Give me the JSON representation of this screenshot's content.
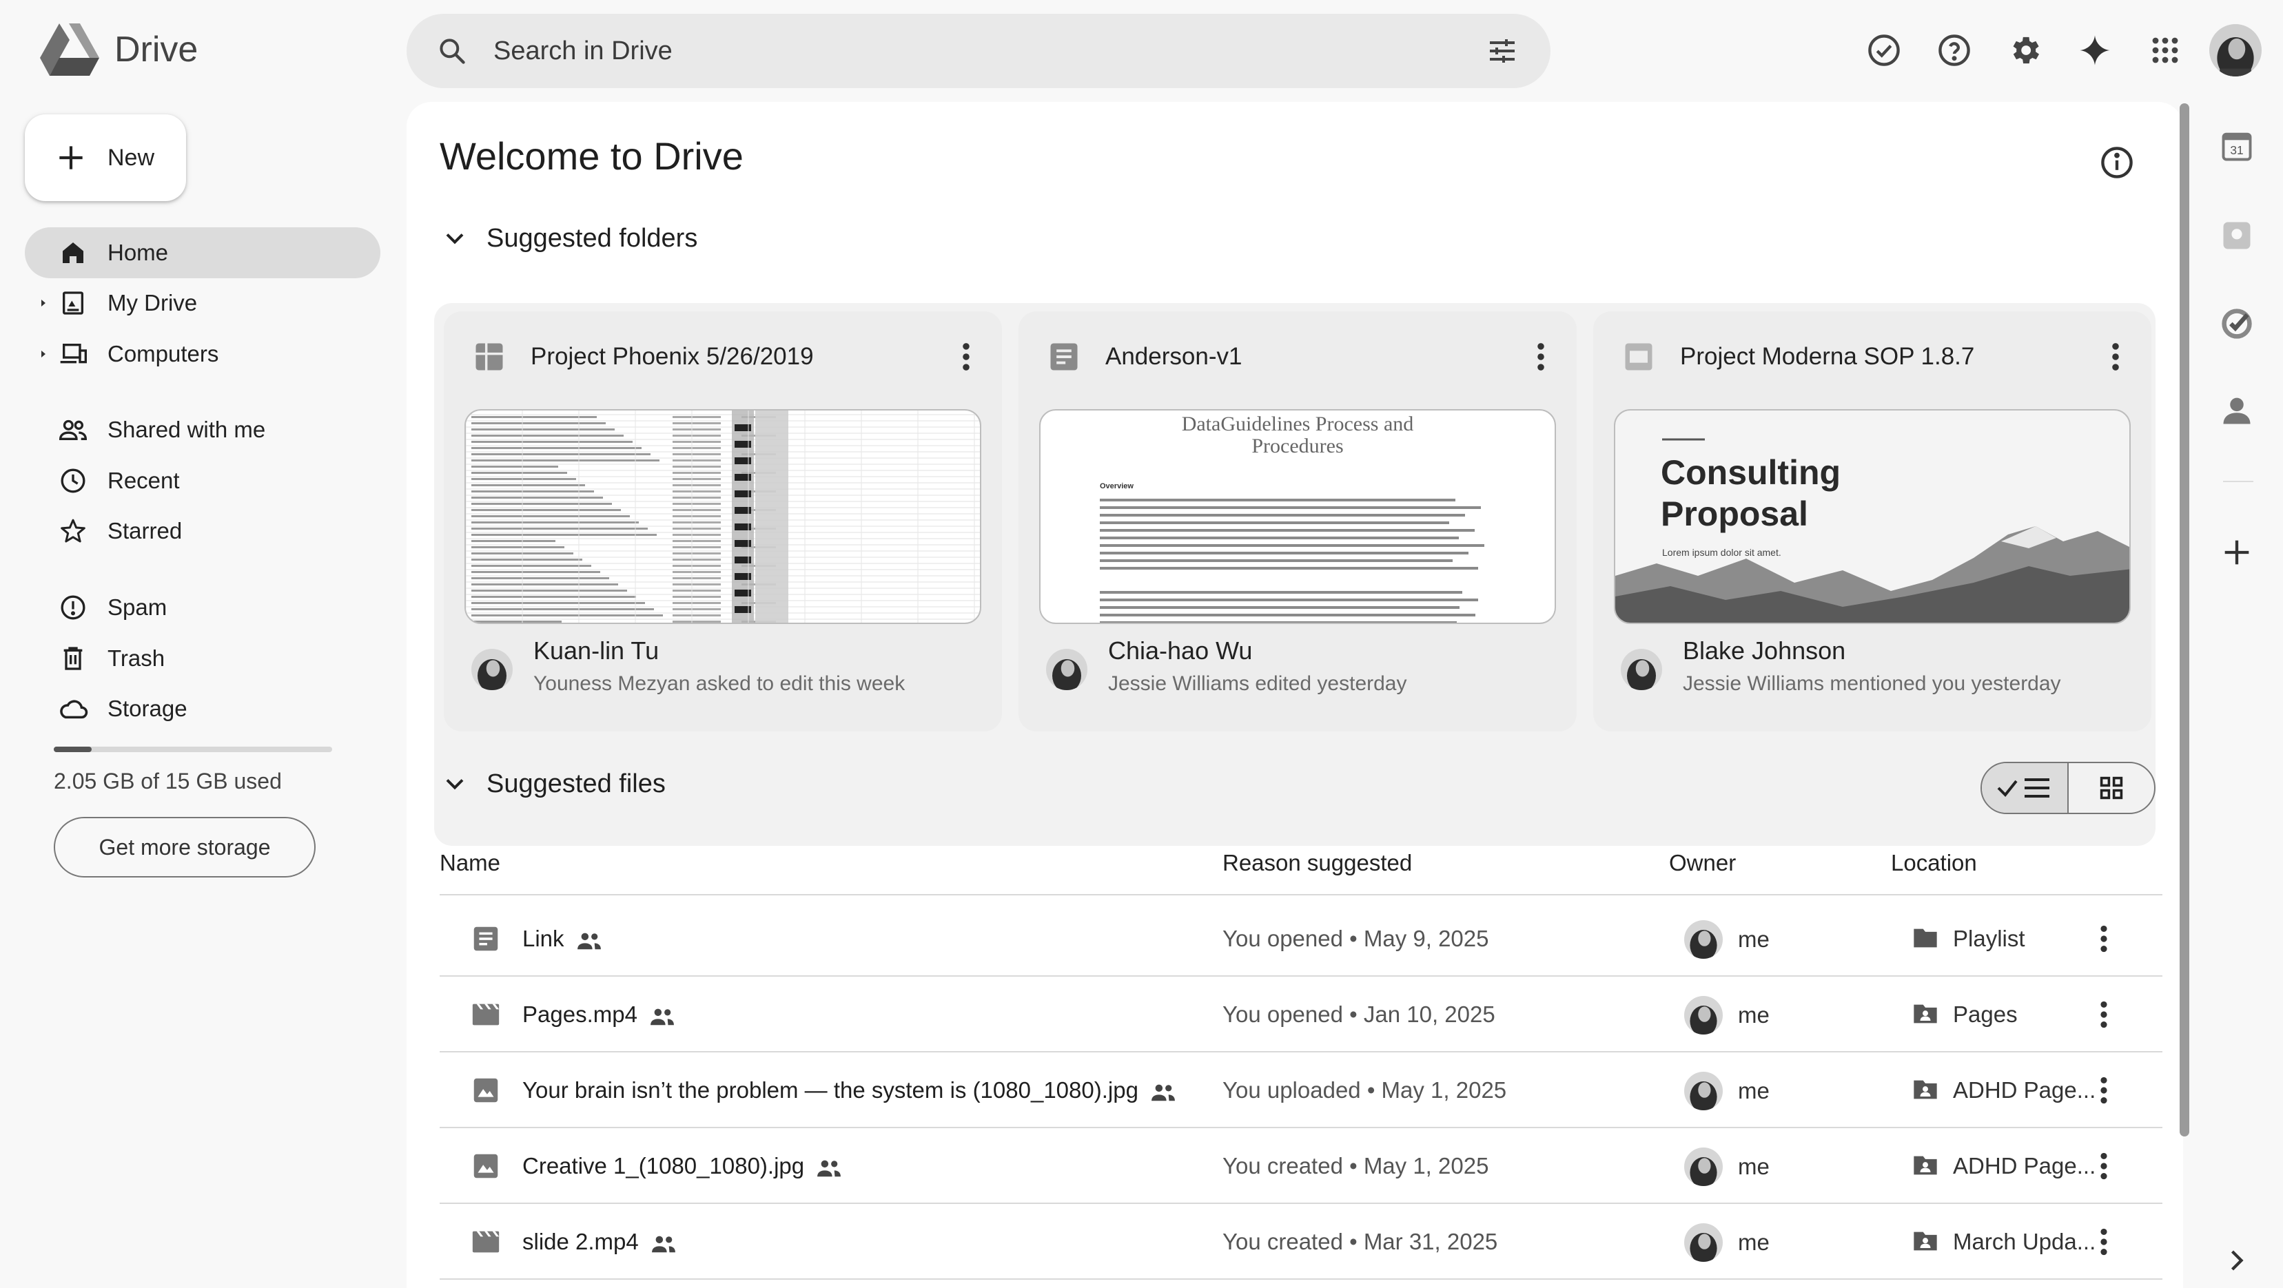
{
  "app": {
    "name": "Drive"
  },
  "search": {
    "placeholder": "Search in Drive"
  },
  "sidebar": {
    "new_label": "New",
    "items": [
      {
        "label": "Home"
      },
      {
        "label": "My Drive"
      },
      {
        "label": "Computers"
      },
      {
        "label": "Shared with me"
      },
      {
        "label": "Recent"
      },
      {
        "label": "Starred"
      },
      {
        "label": "Spam"
      },
      {
        "label": "Trash"
      },
      {
        "label": "Storage"
      }
    ],
    "storage_used_fraction": 0.137,
    "storage_text": "2.05 GB of 15 GB used",
    "get_storage_label": "Get more storage"
  },
  "main": {
    "title": "Welcome to Drive",
    "suggested_folders_label": "Suggested folders",
    "suggested_files_label": "Suggested files"
  },
  "cards": [
    {
      "title": "Project Phoenix 5/26/2019",
      "type_icon": "sheets-icon",
      "owner": "Kuan-lin Tu",
      "activity": "Youness Mezyan asked to edit this week"
    },
    {
      "title": "Anderson-v1",
      "type_icon": "docs-icon",
      "owner": "Chia-hao Wu",
      "activity": "Jessie Williams edited yesterday",
      "thumb_title": "DataGuidelines Process and Procedures",
      "thumb_heading": "Overview"
    },
    {
      "title": "Project Moderna  SOP 1.8.7",
      "type_icon": "slides-icon",
      "owner": "Blake Johnson",
      "activity": "Jessie Williams mentioned you yesterday",
      "thumb_title_line1": "Consulting",
      "thumb_title_line2": "Proposal",
      "thumb_sub": "Lorem ipsum dolor sit amet."
    }
  ],
  "table": {
    "headers": {
      "name": "Name",
      "reason": "Reason suggested",
      "owner": "Owner",
      "location": "Location"
    },
    "rows": [
      {
        "name": "Link",
        "icon": "docs-icon",
        "reason": "You opened • May 9, 2025",
        "owner": "me",
        "location": "Playlist",
        "location_icon": "folder-icon"
      },
      {
        "name": "Pages.mp4",
        "icon": "video-icon",
        "reason": "You opened • Jan 10, 2025",
        "owner": "me",
        "location": "Pages",
        "location_icon": "shared-folder-icon"
      },
      {
        "name": "Your brain isn’t the problem — the system is (1080_1080).jpg",
        "icon": "image-icon",
        "reason": "You uploaded • May 1, 2025",
        "owner": "me",
        "location": "ADHD Page...",
        "location_icon": "shared-folder-icon"
      },
      {
        "name": "Creative 1_(1080_1080).jpg",
        "icon": "image-icon",
        "reason": "You created • May 1, 2025",
        "owner": "me",
        "location": "ADHD Page...",
        "location_icon": "shared-folder-icon"
      },
      {
        "name": "slide 2.mp4",
        "icon": "video-icon",
        "reason": "You created • Mar 31, 2025",
        "owner": "me",
        "location": "March Upda...",
        "location_icon": "shared-folder-icon"
      }
    ]
  },
  "rail": {
    "calendar_day": "31"
  }
}
